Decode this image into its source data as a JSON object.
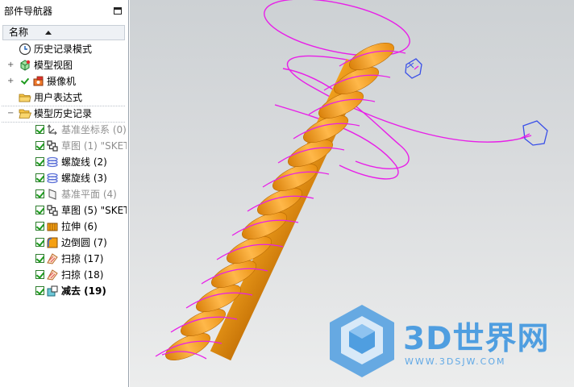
{
  "navigator": {
    "title": "部件导航器",
    "column_header": "名称",
    "items": [
      {
        "label": "历史记录模式",
        "icon": "clock-icon",
        "style": "normal"
      },
      {
        "label": "模型视图",
        "icon": "model-views-icon",
        "style": "normal"
      },
      {
        "label": "摄像机",
        "icon": "camera-icon",
        "style": "normal"
      },
      {
        "label": "用户表达式",
        "icon": "folder-icon",
        "style": "normal"
      },
      {
        "label": "模型历史记录",
        "icon": "folder-open-icon",
        "style": "normal"
      }
    ],
    "features": [
      {
        "label": "基准坐标系 (0)",
        "icon": "datum-csys-icon",
        "style": "gray"
      },
      {
        "label": "草图 (1) \"SKET",
        "icon": "sketch-icon",
        "style": "gray"
      },
      {
        "label": "螺旋线 (2)",
        "icon": "helix-icon",
        "style": "normal"
      },
      {
        "label": "螺旋线 (3)",
        "icon": "helix-icon",
        "style": "normal"
      },
      {
        "label": "基准平面 (4)",
        "icon": "datum-plane-icon",
        "style": "gray"
      },
      {
        "label": "草图 (5) \"SKET",
        "icon": "sketch-icon",
        "style": "normal"
      },
      {
        "label": "拉伸 (6)",
        "icon": "extrude-icon",
        "style": "normal"
      },
      {
        "label": "边倒圆 (7)",
        "icon": "edge-blend-icon",
        "style": "normal"
      },
      {
        "label": "扫掠 (17)",
        "icon": "swept-icon",
        "style": "normal"
      },
      {
        "label": "扫掠 (18)",
        "icon": "swept-icon",
        "style": "normal"
      },
      {
        "label": "减去 (19)",
        "icon": "subtract-icon",
        "style": "bold"
      }
    ]
  },
  "watermark": {
    "logo_icon": "cube-hexagon-icon",
    "brand_3d": "3D",
    "brand_cn": "世界网",
    "url": "WWW.3DSJW.COM"
  },
  "colors": {
    "part_orange": "#f5a012",
    "helix_magenta": "#e81ee8",
    "sketch_blue": "#3a50e8",
    "logo_blue": "#4f9ee0"
  }
}
